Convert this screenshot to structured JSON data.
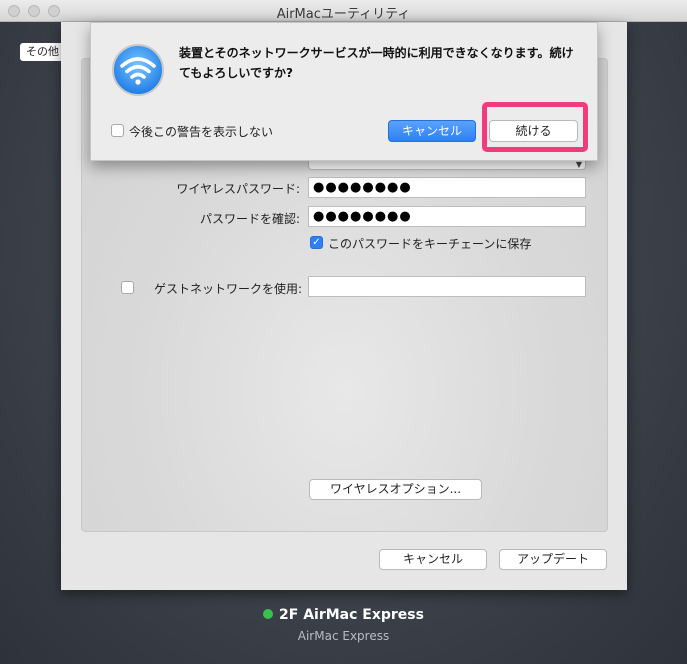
{
  "window": {
    "title": "AirMacユーティリティ"
  },
  "background": {
    "other_button_label": "その他"
  },
  "form": {
    "wireless_password_label": "ワイヤレスパスワード:",
    "wireless_password_value": "●●●●●●●●",
    "confirm_password_label": "パスワードを確認:",
    "confirm_password_value": "●●●●●●●●",
    "keychain_label": "このパスワードをキーチェーンに保存",
    "keychain_checked": true,
    "guest_network_label": "ゲストネットワークを使用:",
    "guest_network_checked": false,
    "guest_network_value": "",
    "wireless_options_label": "ワイヤレスオプション..."
  },
  "sheet_buttons": {
    "cancel_label": "キャンセル",
    "update_label": "アップデート"
  },
  "alert": {
    "message": "装置とそのネットワークサービスが一時的に利用できなくなります。続けてもよろしいですか?",
    "suppress_label": "今後この警告を表示しない",
    "suppress_checked": false,
    "cancel_label": "キャンセル",
    "continue_label": "続ける",
    "icon": "wifi-icon"
  },
  "device": {
    "name": "2F AirMac Express",
    "model": "AirMac Express",
    "status_color": "#39c24a"
  },
  "colors": {
    "accent": "#2d7ff5",
    "highlight": "#f23b7c"
  }
}
